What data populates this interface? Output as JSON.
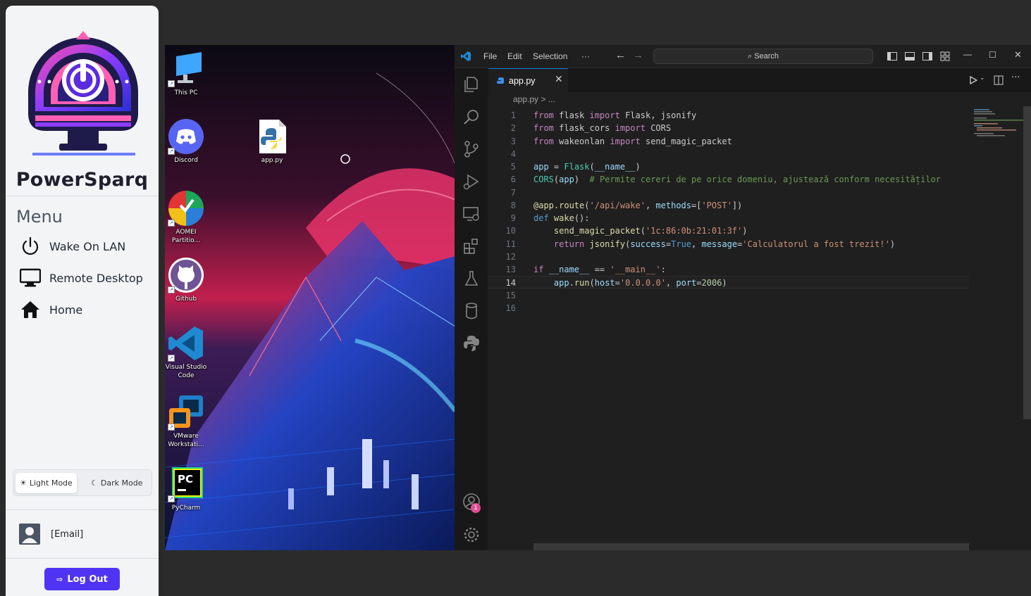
{
  "sidebar": {
    "brand": "PowerSparq",
    "menu_title": "Menu",
    "items": [
      {
        "label": "Wake On LAN",
        "icon": "power-icon"
      },
      {
        "label": "Remote Desktop",
        "icon": "monitor-icon"
      },
      {
        "label": "Home",
        "icon": "home-icon"
      }
    ],
    "light_mode": "Light Mode",
    "dark_mode": "Dark Mode",
    "user_email": "[Email]",
    "logout": "Log Out",
    "accent": "#4f35f3"
  },
  "desktop": {
    "icons": [
      {
        "label": "This PC"
      },
      {
        "label": "Discord"
      },
      {
        "label": "app.py"
      },
      {
        "label": "AOMEI Partitio..."
      },
      {
        "label": "Github"
      },
      {
        "label": "Visual Studio Code"
      },
      {
        "label": "VMware Workstati..."
      },
      {
        "label": "PyCharm"
      }
    ]
  },
  "vscode": {
    "menu": [
      "File",
      "Edit",
      "Selection",
      "···"
    ],
    "search": "Search",
    "tab": "app.py",
    "breadcrumb": "app.py > ...",
    "line_numbers": [
      "1",
      "2",
      "3",
      "4",
      "5",
      "6",
      "7",
      "8",
      "9",
      "10",
      "11",
      "12",
      "13",
      "14",
      "15",
      "16"
    ],
    "current_line": 14,
    "badge": "1"
  }
}
